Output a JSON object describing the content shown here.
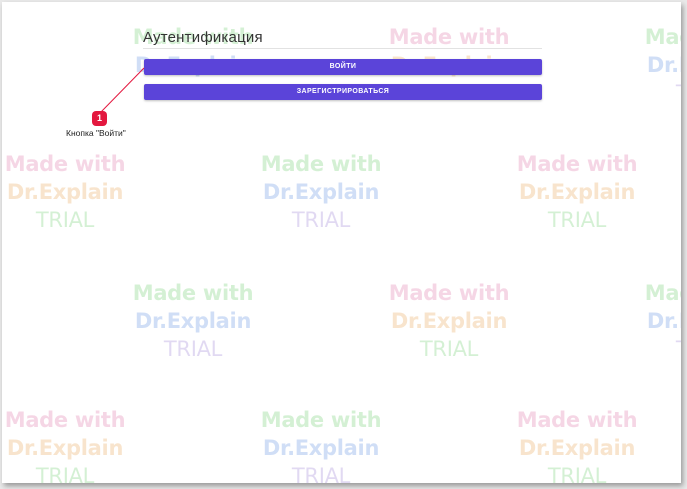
{
  "page": {
    "title": "Аутентификация"
  },
  "buttons": {
    "login_label": "ВОЙТИ",
    "register_label": "ЗАРЕГИСТРИРОВАТЬСЯ"
  },
  "callout": {
    "number": "1",
    "label": "Кнопка \"Войти\""
  },
  "watermark": {
    "line1": "Made with",
    "line2": "Dr.Explain",
    "line3": "TRIAL"
  },
  "colors": {
    "button": "#5b44d9",
    "callout_badge": "#e3183f"
  }
}
